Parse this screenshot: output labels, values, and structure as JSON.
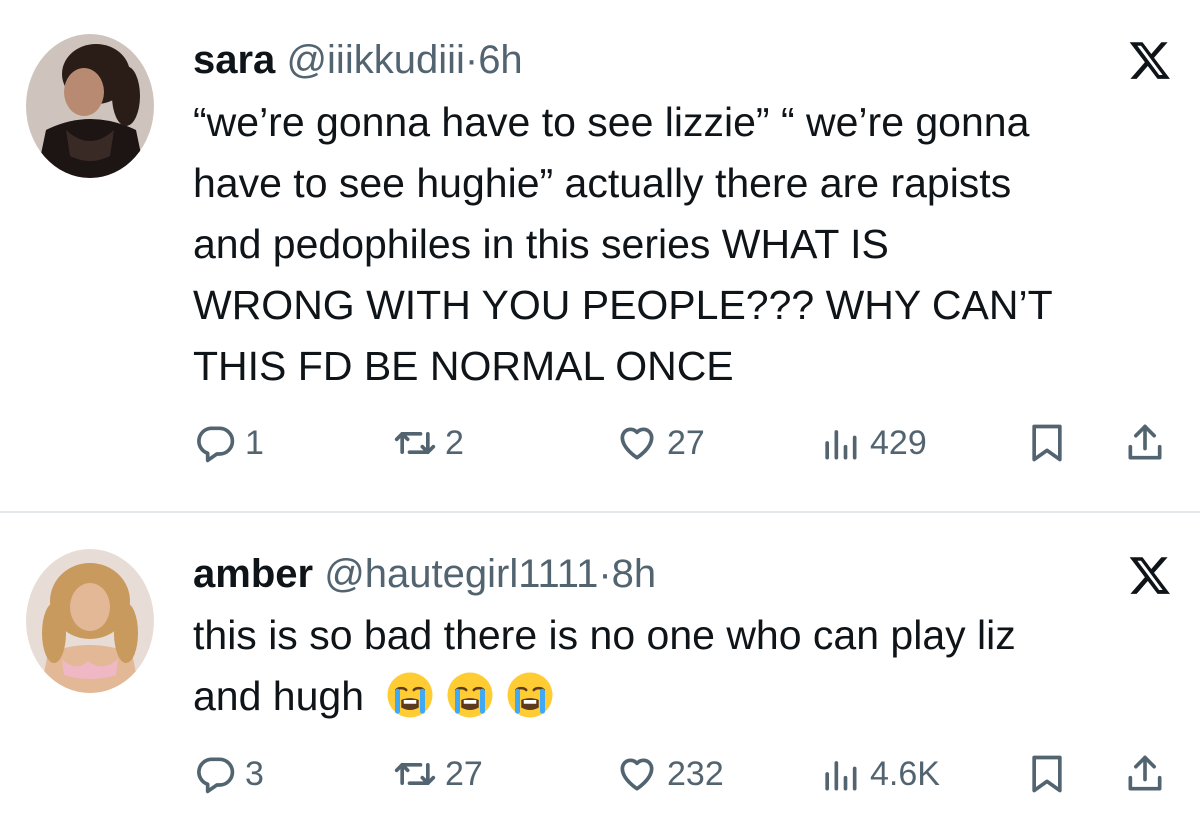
{
  "tweets": [
    {
      "name": "sara",
      "handle": "@iiikkudiii",
      "separator": "·",
      "time": "6h",
      "lines": [
        "“we’re gonna have to see lizzie” “ we’re gonna",
        "have to see hughie” actually there are rapists",
        "and pedophiles in this series WHAT IS",
        "WRONG WITH YOU PEOPLE??? WHY CAN’T",
        "THIS FD BE NORMAL ONCE"
      ],
      "replies": "1",
      "reposts": "2",
      "likes": "27",
      "views": "429"
    },
    {
      "name": "amber",
      "handle": "@hautegirl1111",
      "separator": "·",
      "time": "8h",
      "lines": [
        "this is so bad there is no one who can play liz",
        "and hugh"
      ],
      "emoji": "loudly-crying-face",
      "emoji_count": 3,
      "replies": "3",
      "reposts": "27",
      "likes": "232",
      "views": "4.6K"
    }
  ],
  "icons": {
    "reply": "reply-icon",
    "repost": "repost-icon",
    "like": "heart-icon",
    "views": "views-icon",
    "bookmark": "bookmark-icon",
    "share": "share-icon",
    "brand": "x-logo-icon"
  },
  "colors": {
    "text": "#0f1419",
    "secondary": "#536471",
    "divider": "#e6e9ec"
  }
}
